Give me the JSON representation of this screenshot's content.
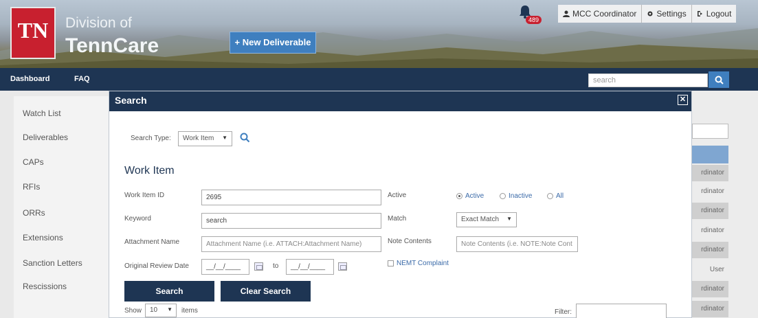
{
  "brand": {
    "logo_abbrev": "TN",
    "division": "Division of",
    "name": "TennCare"
  },
  "header": {
    "new_deliverable_label": "+ New Deliverable",
    "notification_count": "489",
    "user_label": "MCC Coordinator",
    "settings_label": "Settings",
    "logout_label": "Logout"
  },
  "nav": {
    "items": [
      "Dashboard",
      "FAQ"
    ],
    "search_value": "search"
  },
  "sidebar": {
    "items": [
      "Watch List",
      "Deliverables",
      "CAPs",
      "RFIs",
      "ORRs",
      "Extensions",
      "Sanction Letters",
      "Rescissions"
    ]
  },
  "background_table": {
    "cells": [
      "rdinator",
      "rdinator",
      "rdinator",
      "rdinator",
      "rdinator",
      "User",
      "rdinator",
      "rdinator"
    ]
  },
  "modal": {
    "title": "Search",
    "search_type_label": "Search Type:",
    "search_type_value": "Work Item",
    "section_title": "Work Item",
    "fields": {
      "work_item_id_label": "Work Item ID",
      "work_item_id_value": "2695",
      "keyword_label": "Keyword",
      "keyword_value": "search",
      "attachment_label": "Attachment Name",
      "attachment_placeholder": "Attachment Name (i.e. ATTACH:Attachment Name)",
      "review_date_label": "Original Review Date",
      "date_from": "__/__/____",
      "date_to_label": "to",
      "date_to": "__/__/____",
      "active_label": "Active",
      "radio_active": "Active",
      "radio_inactive": "Inactive",
      "radio_all": "All",
      "match_label": "Match",
      "match_value": "Exact Match",
      "note_label": "Note Contents",
      "note_placeholder": "Note Contents (i.e. NOTE:Note Cont",
      "nemt_label": "NEMT Complaint"
    },
    "search_button": "Search",
    "clear_button": "Clear Search",
    "show_label": "Show",
    "show_value": "10",
    "items_label": "items",
    "filter_label": "Filter:"
  },
  "colors": {
    "navy": "#1e3553",
    "brand_red": "#c8202f",
    "accent_blue": "#3f7fbf"
  }
}
